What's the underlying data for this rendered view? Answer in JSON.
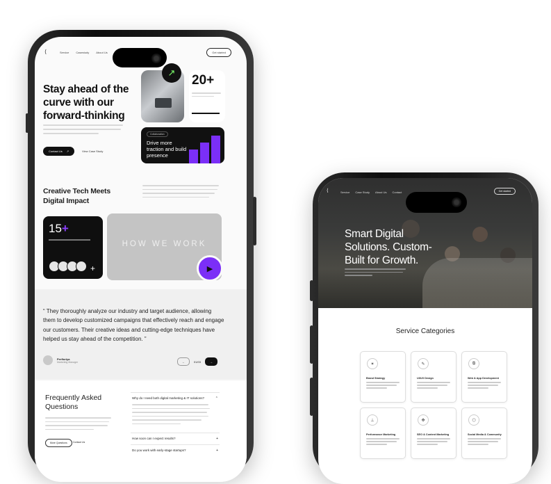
{
  "phone_left": {
    "nav": {
      "logo": "⟨",
      "links": [
        "Service",
        "Casestudy",
        "About Us",
        "Contact"
      ],
      "cta": "Get started"
    },
    "hero": {
      "title": "Stay ahead of the curve with our forward-thinking",
      "primary_button": "Contact Us",
      "secondary_link": "View Case Study"
    },
    "stat_growth": {
      "number": "20+"
    },
    "dark_card": {
      "tag": "Collaboration",
      "text": "Drive more traction and build presence"
    },
    "section2": {
      "title": "Creative Tech Meets Digital Impact"
    },
    "stat_projects": {
      "number": "15",
      "plus": "+"
    },
    "how_we_work": {
      "label": "HOW WE WORK"
    },
    "testimonial": {
      "quote": "“ They thoroughly analyze our industry and target audience, allowing them to develop customized campaigns that effectively reach and engage our customers. Their creative ideas and cutting-edge techniques have helped us stay ahead of the competition. ”",
      "author_name": "Perfioriya",
      "author_role": "Marketing Manager",
      "pager": "01/03"
    },
    "faq": {
      "title": "Frequently Asked Questions",
      "button": "More Questions",
      "link": "Contact Us",
      "items": [
        {
          "q": "Why do I need both digital marketing & IT solutions?",
          "icon": "chevron-up-icon"
        },
        {
          "q": "How soon can I expect results?",
          "icon": "plus-icon"
        },
        {
          "q": "Do you work with early-stage startups?",
          "icon": "plus-icon"
        }
      ]
    }
  },
  "phone_right": {
    "nav": {
      "logo": "⟨",
      "links": [
        "Service",
        "Case Study",
        "About Us",
        "Contact"
      ],
      "cta": "Get started"
    },
    "hero": {
      "title": "Smart Digital Solutions. Custom-Built for Growth."
    },
    "services": {
      "title": "Service Categories",
      "items": [
        {
          "name": "Brand Strategy",
          "icon": "bulb-icon"
        },
        {
          "name": "UI/UX Design",
          "icon": "pen-icon"
        },
        {
          "name": "Web & App Development",
          "icon": "code-icon"
        },
        {
          "name": "Performance Marketing",
          "icon": "chart-icon"
        },
        {
          "name": "SEO & Content Marketing",
          "icon": "search-icon"
        },
        {
          "name": "Social Media & Community",
          "icon": "users-icon"
        }
      ]
    }
  },
  "colors": {
    "accent": "#7b2ff7",
    "dark": "#111111",
    "growth": "#7cff6b"
  }
}
